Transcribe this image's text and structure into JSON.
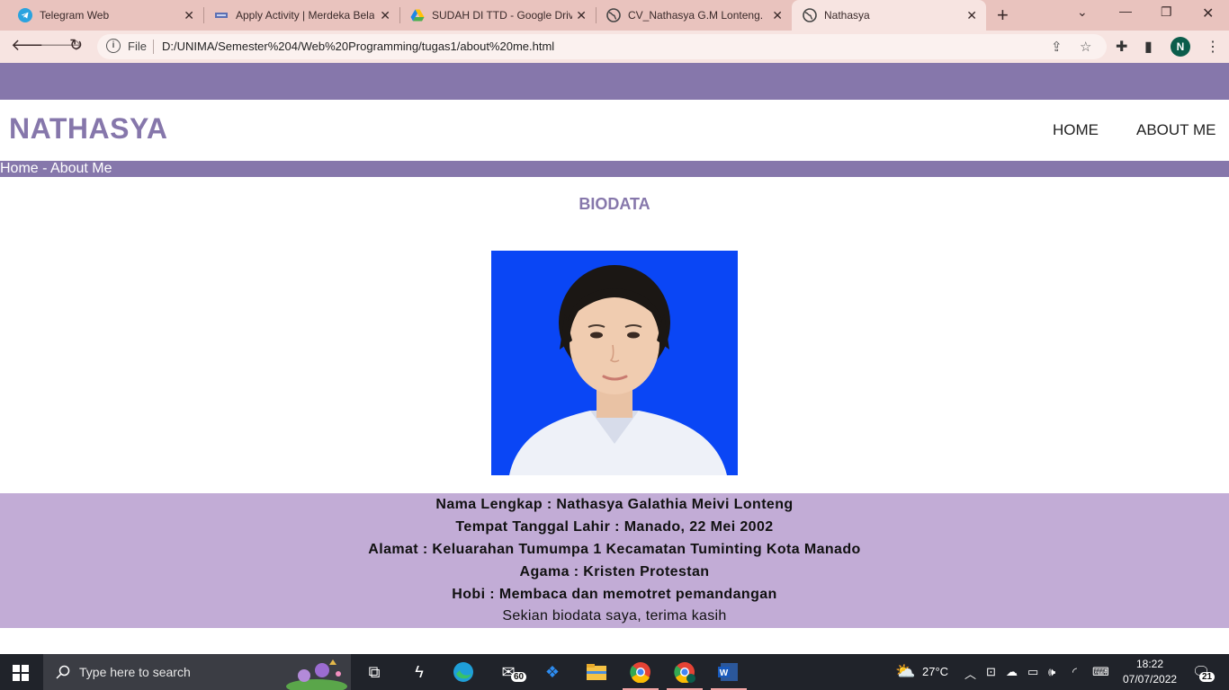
{
  "browser": {
    "tabs": [
      {
        "title": "Telegram Web",
        "icon": "telegram-icon"
      },
      {
        "title": "Apply Activity | Merdeka Belajar",
        "icon": "kampus-merdeka-icon"
      },
      {
        "title": "SUDAH DI TTD - Google Drive",
        "icon": "google-drive-icon"
      },
      {
        "title": "CV_Nathasya G.M Lonteng.pdf",
        "icon": "globe-icon"
      },
      {
        "title": "Nathasya",
        "icon": "globe-icon"
      }
    ],
    "active_tab": 4,
    "address": {
      "scheme_label": "File",
      "url": "D:/UNIMA/Semester%204/Web%20Programming/tugas1/about%20me.html"
    },
    "profile_initial": "N"
  },
  "page": {
    "brand": "NATHASYA",
    "nav": [
      {
        "label": "HOME"
      },
      {
        "label": "ABOUT ME"
      }
    ],
    "breadcrumb": "Home - About Me",
    "section_title": "BIODATA",
    "photo_alt": "Profile photo",
    "bio": [
      "Nama Lengkap : Nathasya Galathia Meivi Lonteng",
      "Tempat Tanggal Lahir : Manado, 22 Mei 2002",
      "Alamat : Keluarahan Tumumpa 1 Kecamatan Tuminting Kota Manado",
      "Agama : Kristen Protestan",
      "Hobi : Membaca dan memotret pemandangan"
    ],
    "closing": "Sekian biodata saya, terima kasih",
    "colors": {
      "accent": "#8677ab",
      "bio_bg": "#c2acd6",
      "photo_bg": "#0a46f5"
    }
  },
  "taskbar": {
    "search_placeholder": "Type here to search",
    "mail_badge": "60",
    "weather": "27°C",
    "time": "18:22",
    "date": "07/07/2022",
    "notification_count": "21"
  }
}
